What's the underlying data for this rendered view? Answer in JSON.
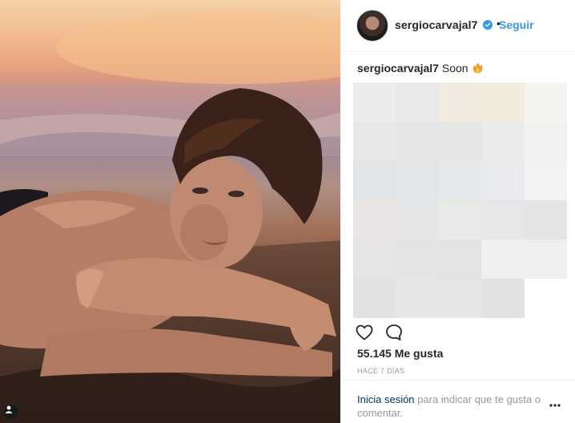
{
  "post": {
    "username": "sergiocarvajal7",
    "verified_icon": "verified-badge-icon",
    "separator": "•",
    "follow_label": "Seguir",
    "caption_user": "sergiocarvajal7",
    "caption_text": "Soon",
    "caption_emoji_icon": "fire-emoji-icon",
    "likes": "55.145 Me gusta",
    "time": "HACE 7 DÍAS"
  },
  "footer": {
    "login_link": "Inicia sesión",
    "login_rest": " para indicar que te gusta o comentar."
  },
  "colors": {
    "accent": "#3897f0",
    "link": "#003569",
    "muted": "#999999",
    "text": "#262626",
    "border": "#efefef"
  },
  "blurred_tiles": [
    "#ececec",
    "#e9e9ea",
    "#f1eadf",
    "#f3ebdc",
    "#f6f4ef",
    "#e8e8e9",
    "#e6e6e7",
    "#e6e6e6",
    "#ebebeb",
    "#f1f1ef",
    "#e2e5e8",
    "#e3e6e9",
    "#e6e9ec",
    "#e9ebee",
    "#f3f3f3",
    "#e8e5e4",
    "#e6e6e6",
    "#e9e9e8",
    "#e7e7e7",
    "#e4e4e4",
    "#e5e5e6",
    "#e3e4e6",
    "#e3e3e5",
    "#efeff0",
    "#efefef",
    "#e2e2e2",
    "#e6e6e6",
    "#e6e6e6",
    "#e2e2e2",
    "#ffffff"
  ]
}
